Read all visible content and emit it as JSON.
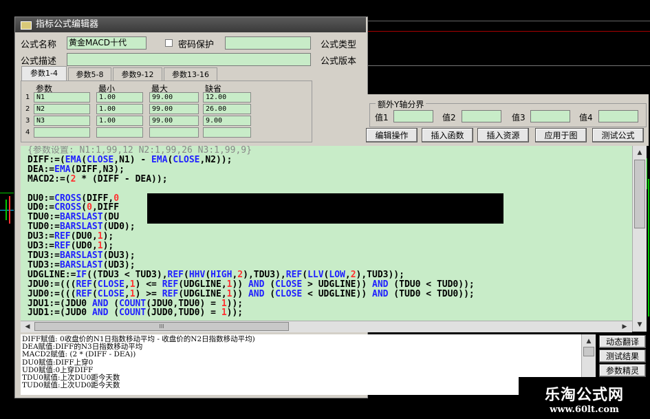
{
  "window": {
    "title": "指标公式编辑器"
  },
  "form": {
    "name_label": "公式名称",
    "name_value": "黄金MACD十代",
    "password_label": "密码保护",
    "type_label": "公式类型",
    "desc_label": "公式描述",
    "version_label": "公式版本"
  },
  "tabs": [
    "参数1-4",
    "参数5-8",
    "参数9-12",
    "参数13-16"
  ],
  "params": {
    "headers": [
      "参数",
      "最小",
      "最大",
      "缺省"
    ],
    "rows": [
      {
        "idx": "1",
        "name": "N1",
        "min": "1.00",
        "max": "99.00",
        "def": "12.00"
      },
      {
        "idx": "2",
        "name": "N2",
        "min": "1.00",
        "max": "99.00",
        "def": "26.00"
      },
      {
        "idx": "3",
        "name": "N3",
        "min": "1.00",
        "max": "99.00",
        "def": "9.00"
      },
      {
        "idx": "4",
        "name": "",
        "min": "",
        "max": "",
        "def": ""
      }
    ]
  },
  "yaxis": {
    "group_label": "额外Y轴分界",
    "labels": [
      "值1",
      "值2",
      "值3",
      "值4"
    ]
  },
  "buttons": [
    "编辑操作",
    "插入函数",
    "插入资源",
    "应用于图",
    "测试公式"
  ],
  "code_lines": [
    "{参数设置: N1:1,99,12 N2:1,99,26 N3:1,99,9}",
    "DIFF:=(EMA(CLOSE,N1) - EMA(CLOSE,N2));",
    "DEA:=EMA(DIFF,N3);",
    "MACD2:=(2 * (DIFF - DEA));",
    "",
    "DU0:=CROSS(DIFF,0",
    "UD0:=CROSS(0,DIFF",
    "TDU0:=BARSLAST(DU",
    "TUD0:=BARSLAST(UD0);",
    "DU3:=REF(DU0,1);",
    "UD3:=REF(UD0,1);",
    "TDU3:=BARSLAST(DU3);",
    "TUD3:=BARSLAST(UD3);",
    "UDGLINE:=IF((TDU3 < TUD3),REF(HHV(HIGH,2),TDU3),REF(LLV(LOW,2),TUD3));",
    "JDU0:=(((REF(CLOSE,1) <= REF(UDGLINE,1)) AND (CLOSE > UDGLINE)) AND (TDU0 < TUD0));",
    "JUD0:=(((REF(CLOSE,1) >= REF(UDGLINE,1)) AND (CLOSE < UDGLINE)) AND (TUD0 < TDU0));",
    "JDU1:=(JDU0 AND (COUNT(JDU0,TDU0) = 1));",
    "JUD1:=(JUD0 AND (COUNT(JUD0,TUD0) = 1));"
  ],
  "hscroll_grip": "III",
  "output_lines": [
    "DIFF赋值: 0收盘价的N1日指数移动平均 - 收盘价的N2日指数移动平均)",
    "DEA赋值:DIFF的N3日指数移动平均",
    "MACD2赋值: (2 * (DIFF - DEA))",
    "DU0赋值:DIFF上穿0",
    "UD0赋值:0上穿DIFF",
    "TDU0赋值:上次DU0距今天数",
    "TUD0赋值:上次UD0距今天数"
  ],
  "side_buttons": [
    "动态翻译",
    "测试结果",
    "参数精灵"
  ],
  "watermark": {
    "line1": "乐淘公式网",
    "line2": "www.60lt.com"
  },
  "colors": {
    "field_bg": "#c8ecc8",
    "keyword": "#2020ff",
    "number": "#ff3030",
    "comment": "#888888"
  }
}
